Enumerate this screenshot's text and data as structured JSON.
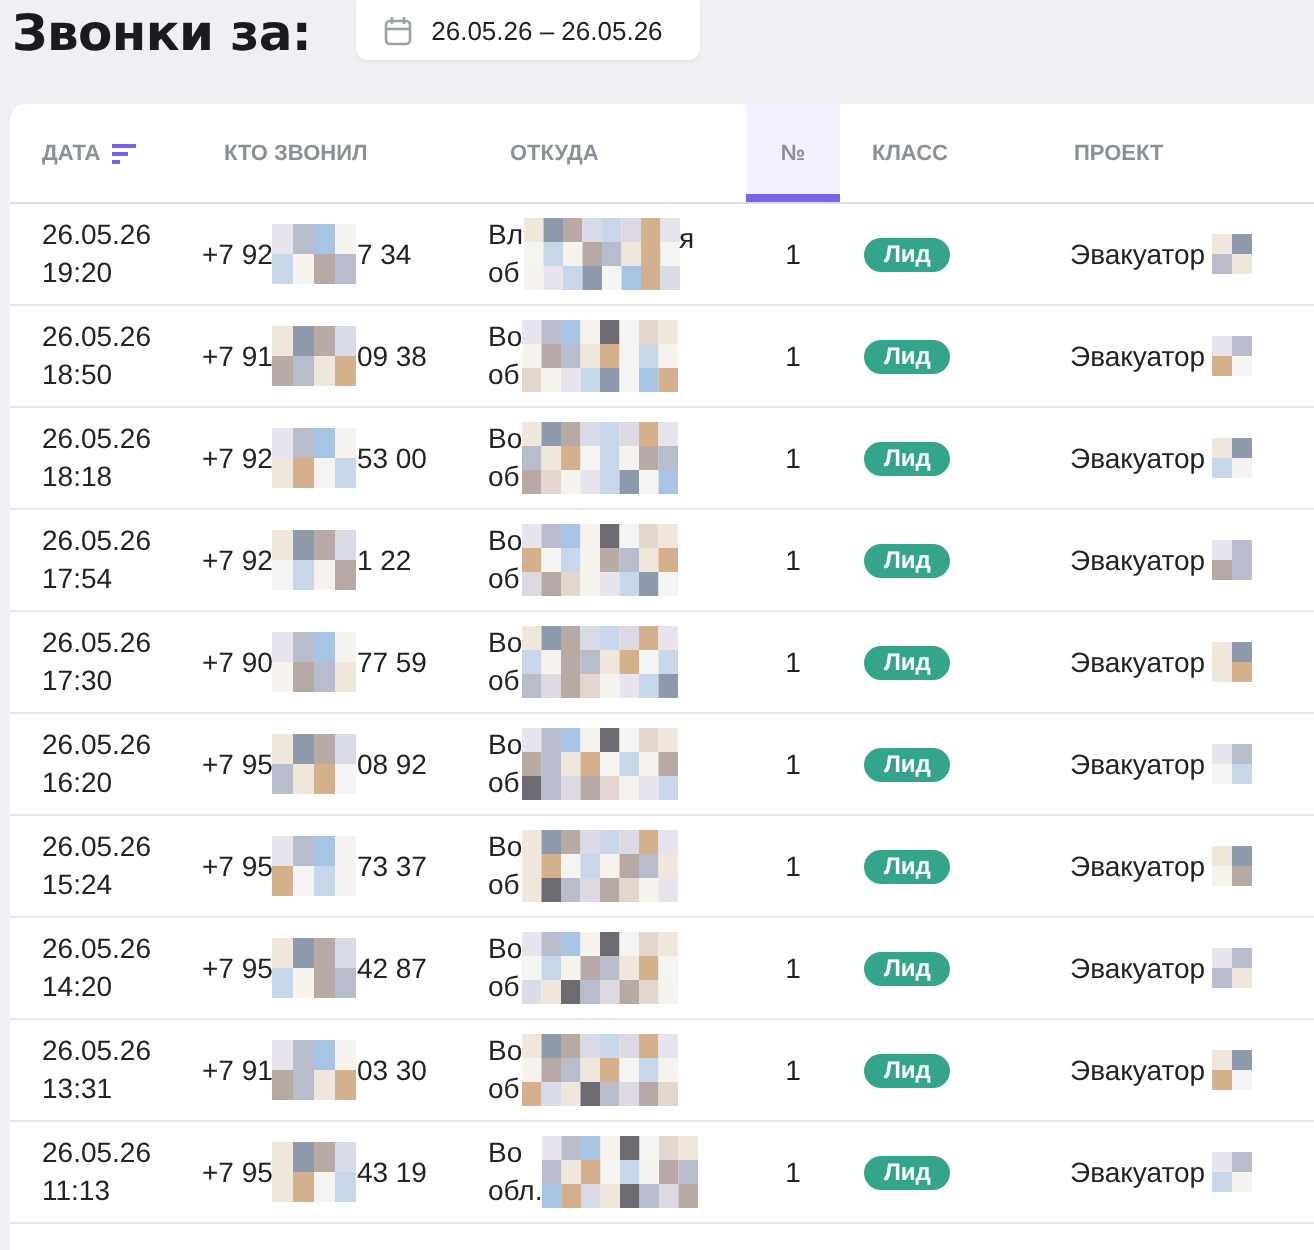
{
  "title": "Звонки за:",
  "date_range": {
    "label": "26.05.26 – 26.05.26"
  },
  "table": {
    "columns": [
      {
        "label": "ДАТА",
        "sorted": true,
        "selected": false
      },
      {
        "label": "КТО ЗВОНИЛ",
        "sorted": false,
        "selected": false
      },
      {
        "label": "ОТКУДА",
        "sorted": false,
        "selected": false
      },
      {
        "label": "№",
        "sorted": false,
        "selected": true
      },
      {
        "label": "КЛАСС",
        "sorted": false,
        "selected": false
      },
      {
        "label": "ПРОЕКТ",
        "sorted": false,
        "selected": false
      }
    ],
    "rows": [
      {
        "date": "26.05.26",
        "time": "19:20",
        "phone_start": "+7 92",
        "phone_end": "7 34",
        "origin_line1": "Вл",
        "origin_tail": "я",
        "origin_line2": "об",
        "number": "1",
        "class": "Лид",
        "project": "Эвакуатор"
      },
      {
        "date": "26.05.26",
        "time": "18:50",
        "phone_start": "+7 91",
        "phone_end": "09 38",
        "origin_line1": "Во",
        "origin_line2": "об",
        "number": "1",
        "class": "Лид",
        "project": "Эвакуатор"
      },
      {
        "date": "26.05.26",
        "time": "18:18",
        "phone_start": "+7 92",
        "phone_end": "53 00",
        "origin_line1": "Во",
        "origin_line2": "об",
        "number": "1",
        "class": "Лид",
        "project": "Эвакуатор"
      },
      {
        "date": "26.05.26",
        "time": "17:54",
        "phone_start": "+7 92",
        "phone_end": "1 22",
        "origin_line1": "Во",
        "origin_line2": "об",
        "number": "1",
        "class": "Лид",
        "project": "Эвакуатор"
      },
      {
        "date": "26.05.26",
        "time": "17:30",
        "phone_start": "+7 90",
        "phone_end": "77 59",
        "origin_line1": "Во",
        "origin_line2": "об",
        "number": "1",
        "class": "Лид",
        "project": "Эвакуатор"
      },
      {
        "date": "26.05.26",
        "time": "16:20",
        "phone_start": "+7 95",
        "phone_end": "08 92",
        "origin_line1": "Во",
        "origin_line2": "об",
        "number": "1",
        "class": "Лид",
        "project": "Эвакуатор"
      },
      {
        "date": "26.05.26",
        "time": "15:24",
        "phone_start": "+7 95",
        "phone_end": "73 37",
        "origin_line1": "Во",
        "origin_line2": "об",
        "number": "1",
        "class": "Лид",
        "project": "Эвакуатор"
      },
      {
        "date": "26.05.26",
        "time": "14:20",
        "phone_start": "+7 95",
        "phone_end": "42 87",
        "origin_line1": "Во",
        "origin_line2": "об",
        "number": "1",
        "class": "Лид",
        "project": "Эвакуатор"
      },
      {
        "date": "26.05.26",
        "time": "13:31",
        "phone_start": "+7 91",
        "phone_end": "03 30",
        "origin_line1": "Во",
        "origin_line2": "об",
        "number": "1",
        "class": "Лид",
        "project": "Эвакуатор"
      },
      {
        "date": "26.05.26",
        "time": "11:13",
        "phone_start": "+7 95",
        "phone_end": "43 19",
        "origin_line1": "Во",
        "origin_line2": "обл.",
        "number": "1",
        "class": "Лид",
        "project": "Эвакуатор"
      }
    ]
  }
}
